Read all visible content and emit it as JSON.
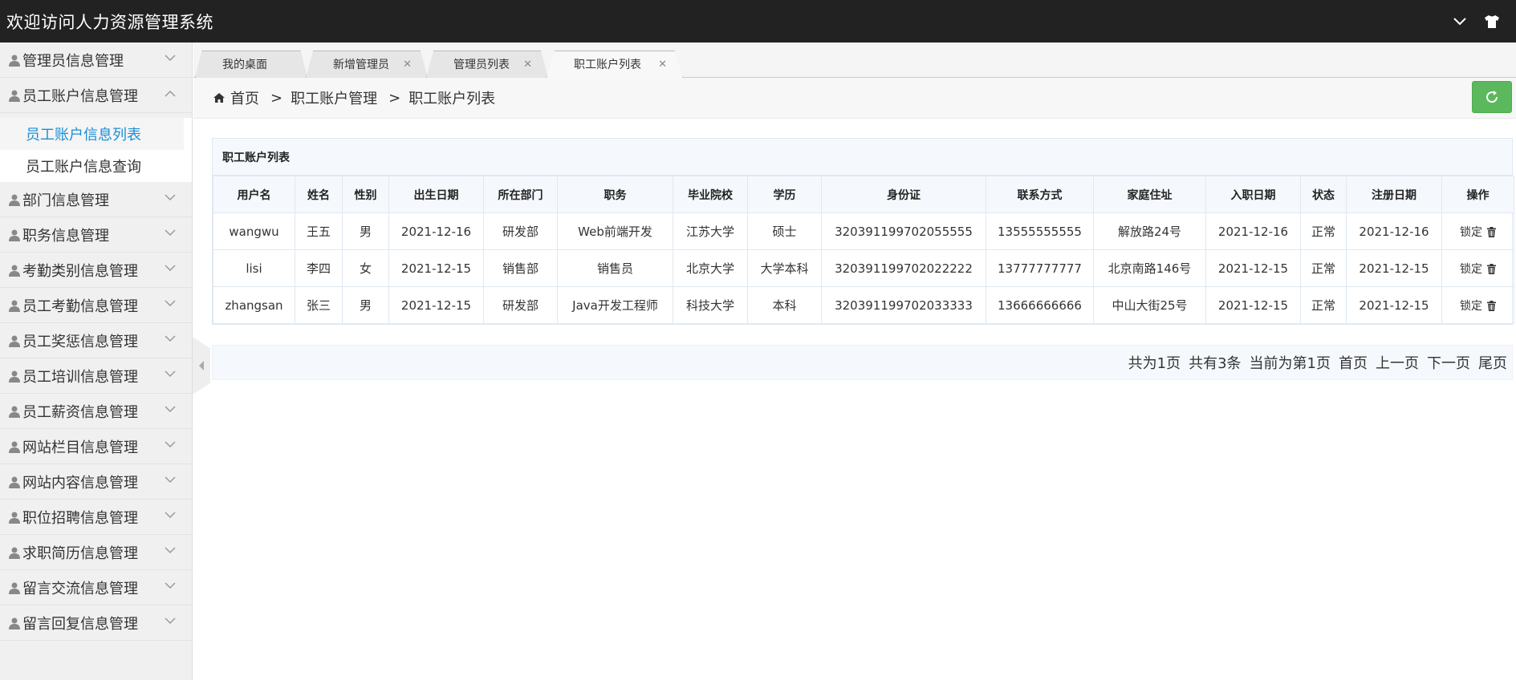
{
  "app": {
    "title": "欢迎访问人力资源管理系统"
  },
  "sidebar": {
    "items": [
      {
        "label": "管理员信息管理"
      },
      {
        "label": "员工账户信息管理"
      },
      {
        "label": "部门信息管理"
      },
      {
        "label": "职务信息管理"
      },
      {
        "label": "考勤类别信息管理"
      },
      {
        "label": "员工考勤信息管理"
      },
      {
        "label": "员工奖惩信息管理"
      },
      {
        "label": "员工培训信息管理"
      },
      {
        "label": "员工薪资信息管理"
      },
      {
        "label": "网站栏目信息管理"
      },
      {
        "label": "网站内容信息管理"
      },
      {
        "label": "职位招聘信息管理"
      },
      {
        "label": "求职简历信息管理"
      },
      {
        "label": "留言交流信息管理"
      },
      {
        "label": "留言回复信息管理"
      }
    ],
    "sub_items": [
      {
        "label": "员工账户信息列表"
      },
      {
        "label": "员工账户信息查询"
      }
    ]
  },
  "tabs": [
    {
      "label": "我的桌面"
    },
    {
      "label": "新增管理员"
    },
    {
      "label": "管理员列表"
    },
    {
      "label": "职工账户列表"
    }
  ],
  "breadcrumb": {
    "home": "首页",
    "sep": ">",
    "level1": "职工账户管理",
    "level2": "职工账户列表"
  },
  "table": {
    "title": "职工账户列表",
    "headers": [
      "用户名",
      "姓名",
      "性别",
      "出生日期",
      "所在部门",
      "职务",
      "毕业院校",
      "学历",
      "身份证",
      "联系方式",
      "家庭住址",
      "入职日期",
      "状态",
      "注册日期",
      "操作"
    ],
    "lock_label": "锁定",
    "rows": [
      [
        "wangwu",
        "王五",
        "男",
        "2021-12-16",
        "研发部",
        "Web前端开发",
        "江苏大学",
        "硕士",
        "320391199702055555",
        "13555555555",
        "解放路24号",
        "2021-12-16",
        "正常",
        "2021-12-16"
      ],
      [
        "lisi",
        "李四",
        "女",
        "2021-12-15",
        "销售部",
        "销售员",
        "北京大学",
        "大学本科",
        "320391199702022222",
        "13777777777",
        "北京南路146号",
        "2021-12-15",
        "正常",
        "2021-12-15"
      ],
      [
        "zhangsan",
        "张三",
        "男",
        "2021-12-15",
        "研发部",
        "Java开发工程师",
        "科技大学",
        "本科",
        "320391199702033333",
        "13666666666",
        "中山大街25号",
        "2021-12-15",
        "正常",
        "2021-12-15"
      ]
    ]
  },
  "pager": {
    "total_pages": "共为1页",
    "total_records": "共有3条",
    "current": "当前为第1页",
    "first": "首页",
    "prev": "上一页",
    "next": "下一页",
    "last": "尾页"
  },
  "icons": {
    "menu_user": "user-icon",
    "chevron": "chevron-down-icon",
    "home": "home-icon",
    "refresh": "refresh-icon",
    "trash": "trash-icon",
    "shirt": "shirt-icon",
    "close": "close-icon"
  },
  "colors": {
    "topbar": "#222222",
    "active_link": "#1a8fd6",
    "refresh_button": "#5cb85c"
  }
}
